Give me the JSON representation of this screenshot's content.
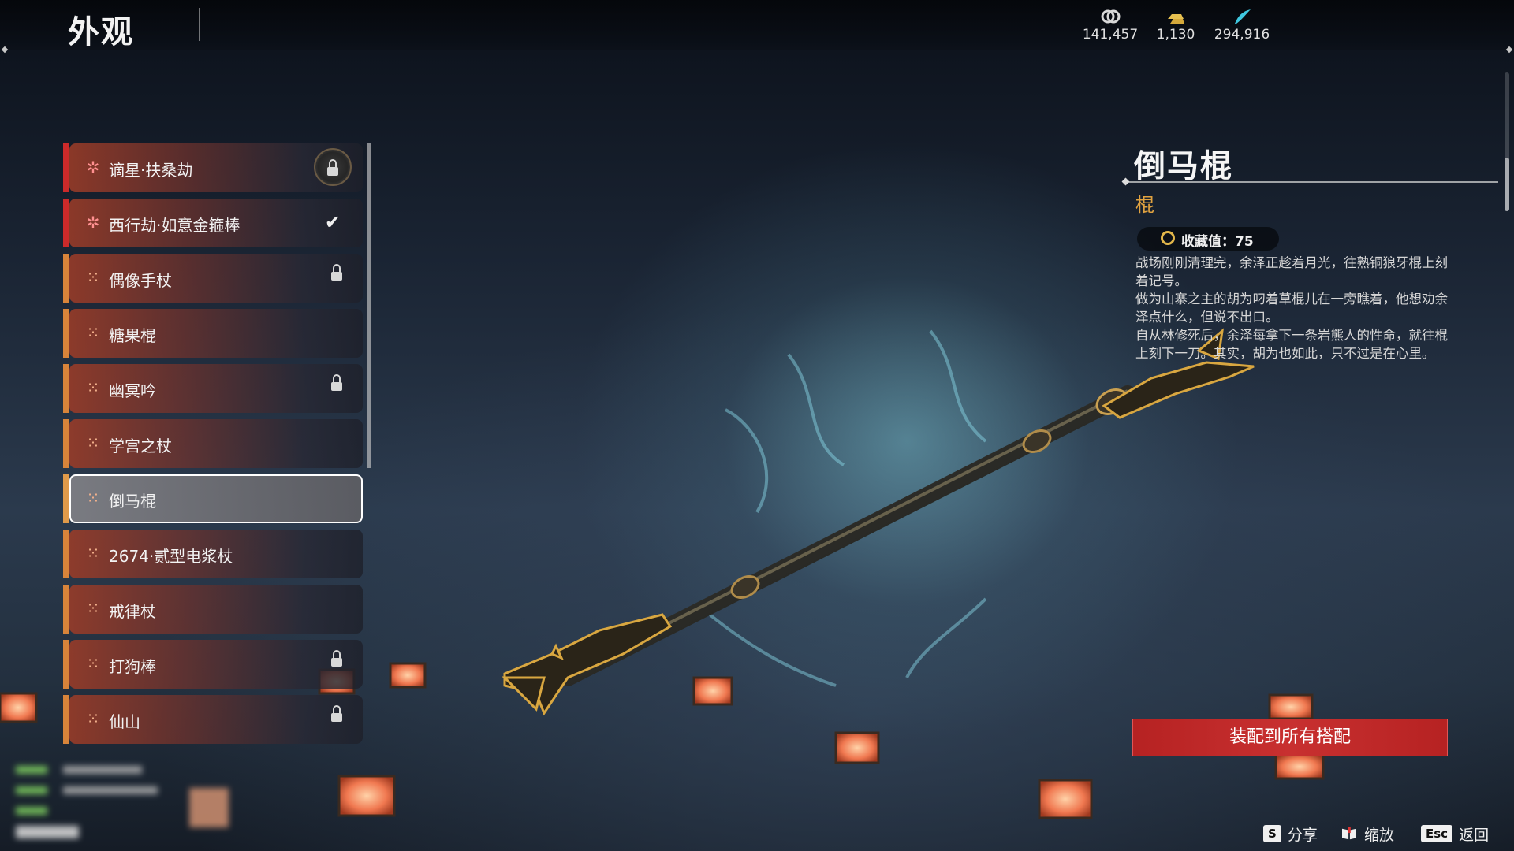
{
  "header": {
    "title": "外观",
    "currencies": [
      {
        "icon": "coins-icon",
        "value": "141,457"
      },
      {
        "icon": "gold-bars-icon",
        "value": "1,130"
      },
      {
        "icon": "feather-gem-icon",
        "value": "294,916"
      }
    ]
  },
  "list": {
    "items": [
      {
        "label": "谪星·扶桑劫",
        "rarity": "red",
        "icon": "star-icon",
        "state": "badge-locked"
      },
      {
        "label": "西行劫·如意金箍棒",
        "rarity": "red",
        "icon": "star-icon",
        "state": "equipped"
      },
      {
        "label": "偶像手杖",
        "rarity": "orange",
        "icon": "quad-dot-icon",
        "state": "locked"
      },
      {
        "label": "糖果棍",
        "rarity": "orange",
        "icon": "quad-dot-icon",
        "state": ""
      },
      {
        "label": "幽冥吟",
        "rarity": "orange",
        "icon": "quad-dot-icon",
        "state": "locked"
      },
      {
        "label": "学宫之杖",
        "rarity": "orange",
        "icon": "quad-dot-icon",
        "state": ""
      },
      {
        "label": "倒马棍",
        "rarity": "orange",
        "icon": "quad-dot-icon",
        "state": "selected"
      },
      {
        "label": "2674·贰型电浆杖",
        "rarity": "orange",
        "icon": "quad-dot-icon",
        "state": ""
      },
      {
        "label": "戒律杖",
        "rarity": "orange",
        "icon": "quad-dot-icon",
        "state": ""
      },
      {
        "label": "打狗棒",
        "rarity": "orange",
        "icon": "quad-dot-icon",
        "state": "locked"
      },
      {
        "label": "仙山",
        "rarity": "orange",
        "icon": "quad-dot-icon",
        "state": "locked"
      }
    ]
  },
  "detail": {
    "name": "倒马棍",
    "type": "棍",
    "collect_label": "收藏值：75",
    "description": [
      "战场刚刚清理完，余泽正趁着月光，往熟铜狼牙棍上刻着记号。",
      "做为山寨之主的胡为叼着草棍儿在一旁瞧着，他想劝余泽点什么，但说不出口。",
      "自从林修死后，余泽每拿下一条岩熊人的性命，就往棍上刻下一刀。其实，胡为也如此，只不过是在心里。"
    ],
    "equip_button": "装配到所有搭配"
  },
  "hints": [
    {
      "key": "S",
      "label": "分享"
    },
    {
      "key": "book-icon",
      "label": "缩放"
    },
    {
      "key": "Esc",
      "label": "返回"
    }
  ],
  "colors": {
    "red_rarity": "#cc2a2a",
    "orange_rarity": "#d8843a",
    "accent_type": "#e0a240",
    "equip_button": "#c83030"
  }
}
